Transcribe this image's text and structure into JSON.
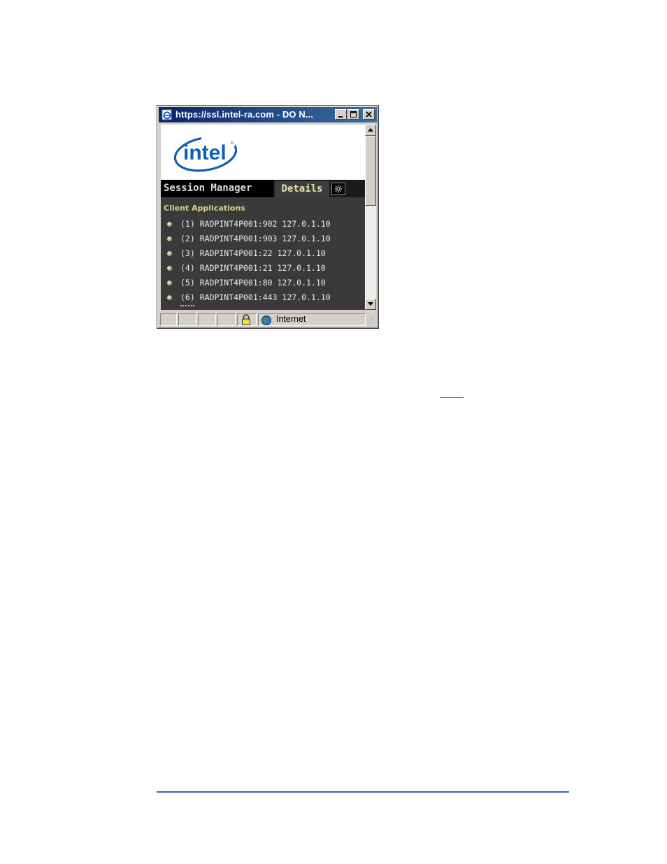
{
  "window": {
    "title": "https://ssl.intel-ra.com - DO N...",
    "buttons": {
      "minimize": "minimize",
      "maximize": "maximize",
      "close": "close"
    }
  },
  "content": {
    "logo_text": "intel",
    "tabs": [
      {
        "label": "Session Manager",
        "active": false
      },
      {
        "label": "Details",
        "active": true
      }
    ],
    "tab_icon": "settings-gear-icon",
    "section_title": "Client Applications",
    "client_applications": [
      "(1) RADPINT4P001:902 127.0.1.10",
      "(2) RADPINT4P001:903 127.0.1.10",
      "(3) RADPINT4P001:22 127.0.1.10",
      "(4) RADPINT4P001:21 127.0.1.10",
      "(5) RADPINT4P001:80 127.0.1.10",
      "(6) RADPINT4P001:443 127.0.1.10"
    ]
  },
  "statusbar": {
    "icons": [
      "lock-icon",
      "globe-icon"
    ],
    "zone": "Internet"
  },
  "page": {
    "link_text": "",
    "colors": {
      "rule": "#3b5ed7",
      "link": "#2a38c8",
      "titlebar": "#0a246a"
    }
  }
}
